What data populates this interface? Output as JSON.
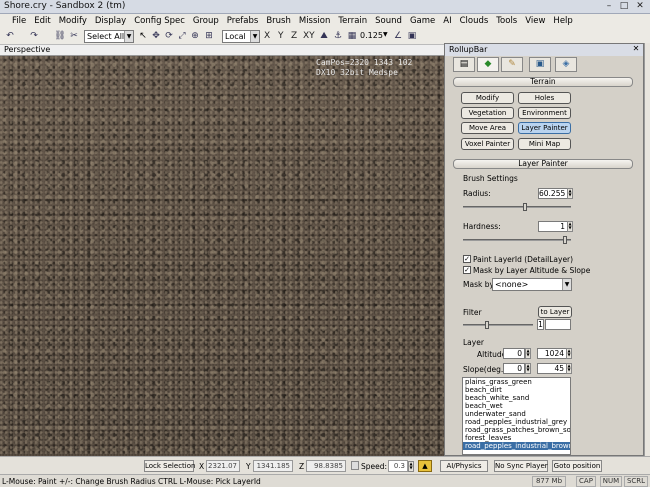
{
  "window": {
    "title": "Shore.cry - Sandbox 2 (tm)"
  },
  "menu": [
    "File",
    "Edit",
    "Modify",
    "Display",
    "Config Spec",
    "Group",
    "Prefabs",
    "Brush",
    "Mission",
    "Terrain",
    "Sound",
    "Game",
    "AI",
    "Clouds",
    "Tools",
    "View",
    "Help"
  ],
  "toolbar": {
    "select_all": "Select All",
    "coord_system": "Local",
    "axes": [
      "X",
      "Y",
      "Z",
      "XY"
    ],
    "grid_value": "0.125"
  },
  "viewport": {
    "label": "Perspective",
    "overlay_line1": "CamPos=2320 1343 102",
    "overlay_line2": "DX10 32bit Medspe"
  },
  "rollup": {
    "title": "RollupBar",
    "terrain_section": "Terrain",
    "buttons": [
      "Modify",
      "Holes",
      "Vegetation",
      "Environment",
      "Move Area",
      "Layer Painter",
      "Voxel Painter",
      "Mini Map"
    ],
    "layer_painter_section": "Layer Painter",
    "brush_settings": "Brush Settings",
    "radius_label": "Radius:",
    "radius_value": "60.255",
    "hardness_label": "Hardness:",
    "hardness_value": "1",
    "paint_layer_label": "Paint LayerId (DetailLayer)",
    "mask_altitude_label": "Mask by Layer Altitude & Slope",
    "mask_by_label": "Mask by",
    "mask_by_value": "<none>",
    "filter_label": "Filter",
    "to_layer_label": "to Layer",
    "filter_value": "1",
    "layer_label": "Layer",
    "altitude_label": "Altitude",
    "altitude_min": "0",
    "altitude_max": "1024",
    "slope_label": "Slope(deg.)",
    "slope_min": "0",
    "slope_max": "45",
    "layers": [
      "plains_grass_green",
      "beach_dirt",
      "beach_white_sand",
      "beach_wet",
      "underwater_sand",
      "road_pepples_industrial_grey",
      "road_grass_patches_brown_soil",
      "forest_leaves",
      "road_pepples_industrial_brown"
    ]
  },
  "bottombar": {
    "lock_selection": "Lock Selection",
    "x_label": "X",
    "x_value": "2321.07",
    "y_label": "Y",
    "y_value": "1341.185",
    "z_label": "Z",
    "z_value": "98.8385",
    "speed_label": "Speed:",
    "speed_value": "0.3",
    "ai_physics": "AI/Physics",
    "no_sync_player": "No Sync Player",
    "goto_position": "Goto position"
  },
  "statusbar": {
    "hint": "L-Mouse: Paint   +/-: Change Brush Radius   CTRL L-Mouse: Pick LayerId",
    "memory": "877 Mb",
    "cap": "CAP",
    "num": "NUM",
    "scrl": "SCRL"
  }
}
